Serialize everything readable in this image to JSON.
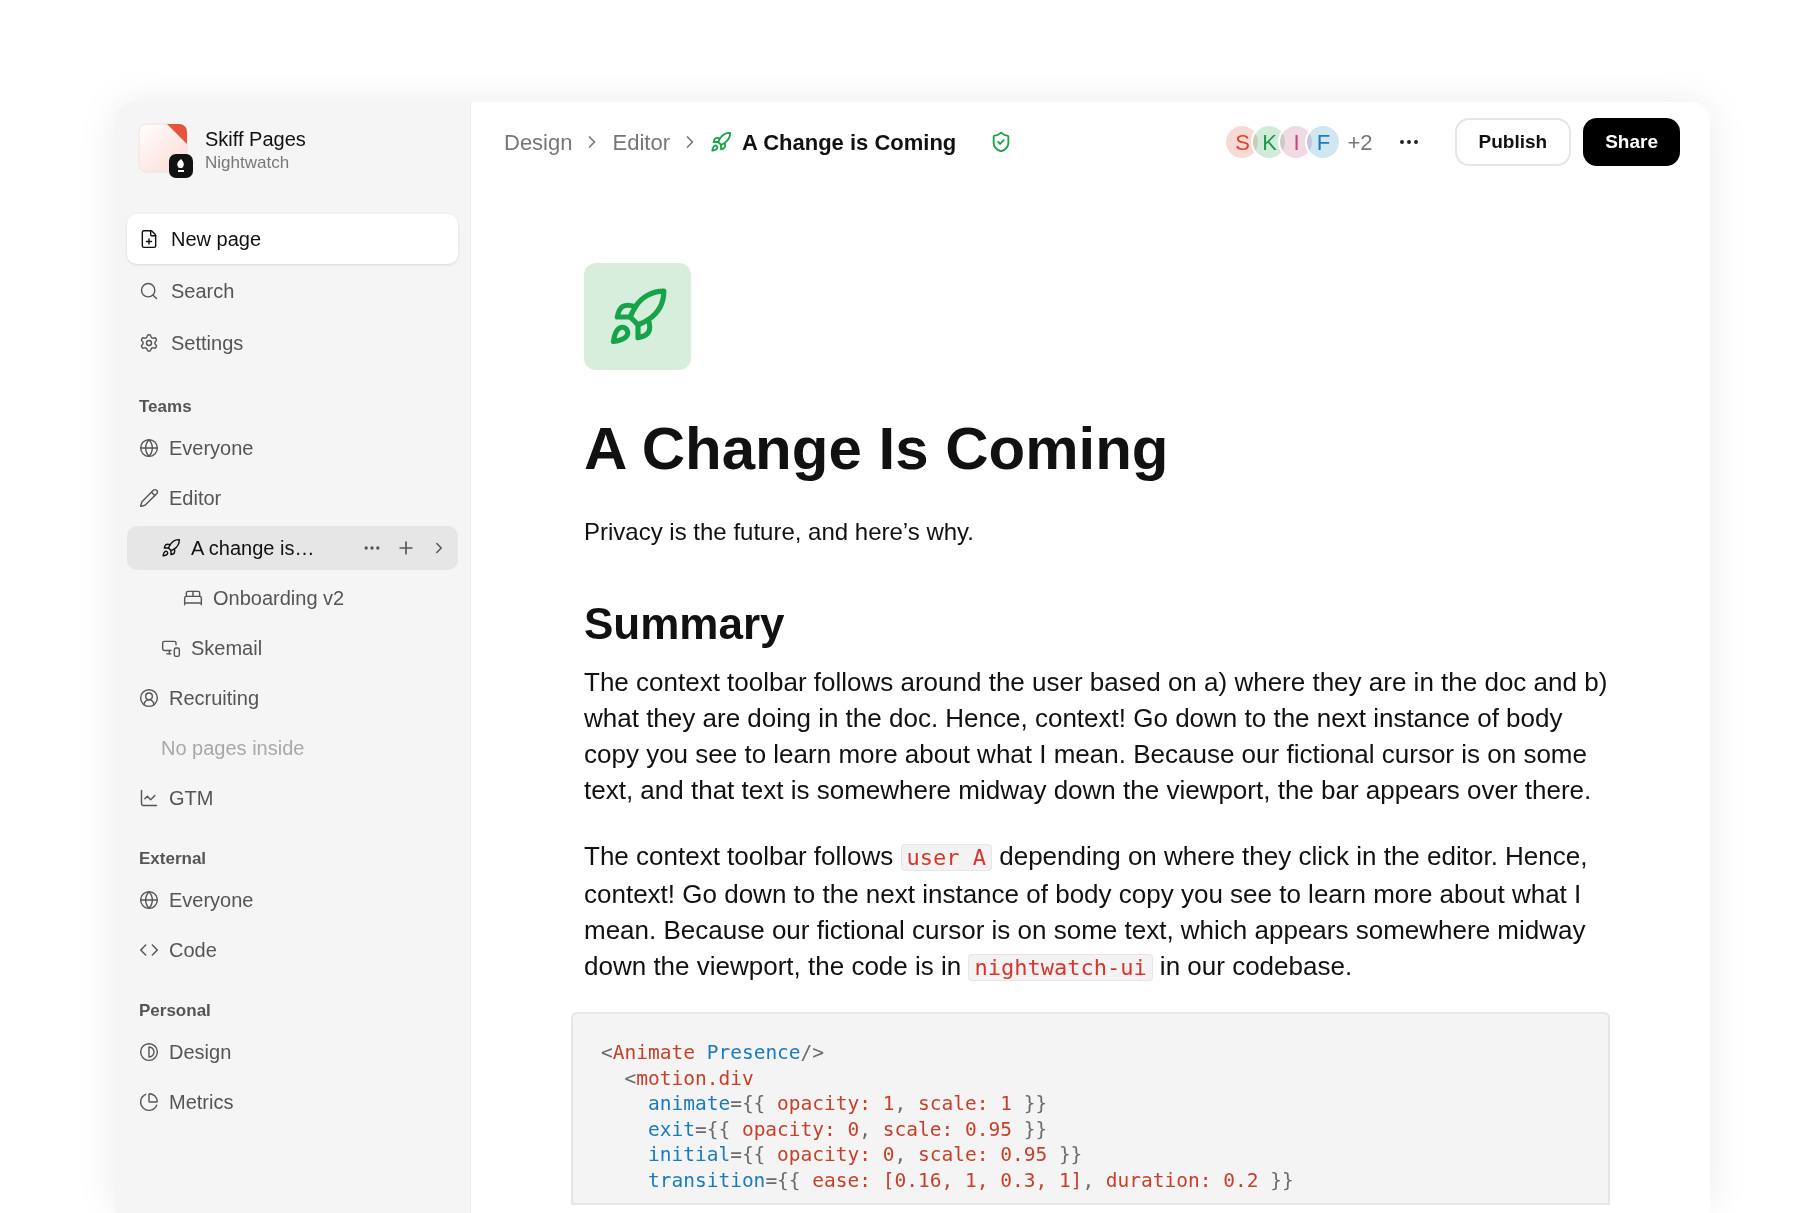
{
  "workspace": {
    "name": "Skiff Pages",
    "org": "Nightwatch"
  },
  "sidebar": {
    "actions": [
      {
        "label": "New page",
        "selected": true
      },
      {
        "label": "Search",
        "selected": false
      },
      {
        "label": "Settings",
        "selected": false
      }
    ],
    "sections": [
      {
        "title": "Teams",
        "items": [
          {
            "label": "Everyone",
            "selected": false
          },
          {
            "label": "Editor",
            "selected": false,
            "children": [
              {
                "label": "A change is…",
                "selected": true,
                "children": [
                  {
                    "label": "Onboarding v2",
                    "selected": false
                  }
                ]
              },
              {
                "label": "Skemail",
                "selected": false
              }
            ]
          },
          {
            "label": "Recruiting",
            "selected": false,
            "empty_note": "No pages inside"
          },
          {
            "label": "GTM",
            "selected": false
          }
        ]
      },
      {
        "title": "External",
        "items": [
          {
            "label": "Everyone",
            "selected": false
          },
          {
            "label": "Code",
            "selected": false
          }
        ]
      },
      {
        "title": "Personal",
        "items": [
          {
            "label": "Design",
            "selected": false
          },
          {
            "label": "Metrics",
            "selected": false
          }
        ]
      }
    ]
  },
  "breadcrumb": [
    {
      "label": "Design",
      "current": false
    },
    {
      "label": "Editor",
      "current": false
    },
    {
      "label": "A Change is Coming",
      "current": true
    }
  ],
  "collaborators": [
    {
      "initial": "S",
      "color": "#d9472b"
    },
    {
      "initial": "K",
      "color": "#1a9a4a"
    },
    {
      "initial": "I",
      "color": "#c0487f"
    },
    {
      "initial": "F",
      "color": "#1b7bbd"
    }
  ],
  "more_collaborators": "+2",
  "buttons": [
    {
      "label": "Publish",
      "kind": "outline"
    },
    {
      "label": "Share",
      "kind": "solid"
    }
  ],
  "document": {
    "title": "A Change Is Coming",
    "subtitle": "Privacy is the future, and here’s why.",
    "heading": "Summary",
    "paragraphs": [
      [
        {
          "kind": "text",
          "text": "The context toolbar follows around the user based on a) where they are in the doc and b) what they are doing in the doc. Hence, context! Go down to the next instance of body copy you see to learn more about what I mean. Because our fictional cursor is on some text, and that text is somewhere midway down the viewport, the bar appears over there."
        }
      ],
      [
        {
          "kind": "text",
          "text": "The context toolbar follows "
        },
        {
          "kind": "code",
          "text": "user A"
        },
        {
          "kind": "text",
          "text": " depending on where they click in the editor. Hence, context! Go down to the next instance of body copy you see to learn more about what I mean. Because our fictional cursor is on some text, which appears somewhere midway down the viewport, the code is in "
        },
        {
          "kind": "code",
          "text": "nightwatch-ui"
        },
        {
          "kind": "text",
          "text": " in our codebase."
        }
      ]
    ],
    "code": [
      [
        {
          "kind": "punct",
          "text": "<"
        },
        {
          "kind": "tag",
          "text": "Animate"
        },
        {
          "kind": "attr",
          "text": " Presence"
        },
        {
          "kind": "punct",
          "text": "/>"
        }
      ],
      [
        {
          "kind": "punct",
          "text": "  <"
        },
        {
          "kind": "tag",
          "text": "motion.div"
        }
      ],
      [
        {
          "kind": "attr",
          "text": "    animate"
        },
        {
          "kind": "punct",
          "text": "={{ "
        },
        {
          "kind": "value",
          "text": "opacity: 1"
        },
        {
          "kind": "punct",
          "text": ", "
        },
        {
          "kind": "value",
          "text": "scale: 1"
        },
        {
          "kind": "punct",
          "text": " }}"
        }
      ],
      [
        {
          "kind": "attr",
          "text": "    exit"
        },
        {
          "kind": "punct",
          "text": "={{ "
        },
        {
          "kind": "value",
          "text": "opacity: 0"
        },
        {
          "kind": "punct",
          "text": ", "
        },
        {
          "kind": "value",
          "text": "scale: 0.95"
        },
        {
          "kind": "punct",
          "text": " }}"
        }
      ],
      [
        {
          "kind": "attr",
          "text": "    initial"
        },
        {
          "kind": "punct",
          "text": "={{ "
        },
        {
          "kind": "value",
          "text": "opacity: 0"
        },
        {
          "kind": "punct",
          "text": ", "
        },
        {
          "kind": "value",
          "text": "scale: 0.95"
        },
        {
          "kind": "punct",
          "text": " }}"
        }
      ],
      [
        {
          "kind": "attr",
          "text": "    transition"
        },
        {
          "kind": "punct",
          "text": "={{ "
        },
        {
          "kind": "value",
          "text": "ease: [0.16, 1, 0.3, 1]"
        },
        {
          "kind": "punct",
          "text": ", "
        },
        {
          "kind": "value",
          "text": "duration: 0.2"
        },
        {
          "kind": "punct",
          "text": " }}"
        }
      ]
    ]
  }
}
